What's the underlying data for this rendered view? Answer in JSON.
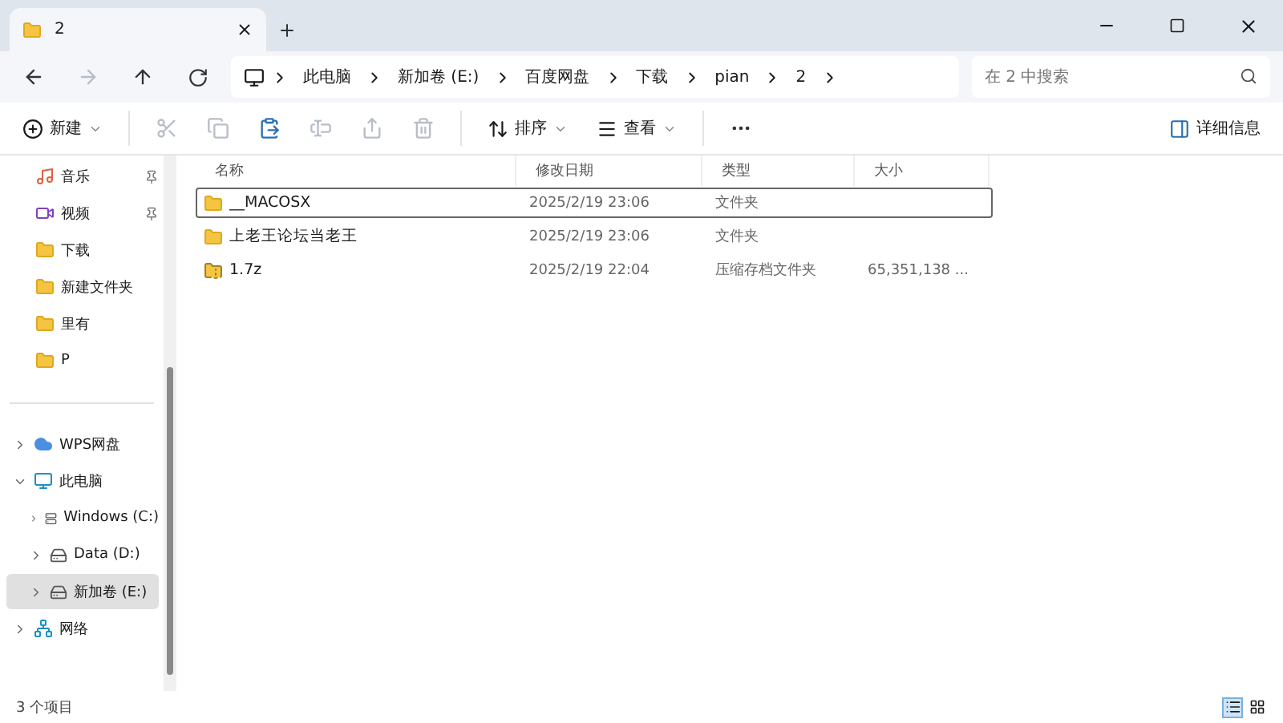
{
  "tab": {
    "title": "2",
    "selected": true
  },
  "nav": {
    "back_disabled": false,
    "forward_disabled": true
  },
  "breadcrumb": [
    "此电脑",
    "新加卷 (E:)",
    "百度网盘",
    "下载",
    "pian",
    "2"
  ],
  "search": {
    "placeholder": "在 2 中搜索"
  },
  "toolbar": {
    "new_label": "新建",
    "actions": [
      {
        "kind": "cut",
        "disabled": true
      },
      {
        "kind": "copy",
        "disabled": true
      },
      {
        "kind": "paste",
        "disabled": false
      },
      {
        "kind": "rename",
        "disabled": true
      },
      {
        "kind": "share",
        "disabled": true
      },
      {
        "kind": "delete",
        "disabled": true
      }
    ],
    "sort_label": "排序",
    "view_label": "查看",
    "details_label": "详细信息"
  },
  "sidebar": {
    "quick": [
      {
        "label": "音乐",
        "kind": "music",
        "pinned": true
      },
      {
        "label": "视频",
        "kind": "video",
        "pinned": true
      },
      {
        "label": "下载",
        "kind": "folder",
        "pinned": false
      },
      {
        "label": "新建文件夹",
        "kind": "folder",
        "pinned": false
      },
      {
        "label": "里有",
        "kind": "folder",
        "pinned": false
      },
      {
        "label": "P",
        "kind": "folder",
        "pinned": false
      }
    ],
    "tree": [
      {
        "label": "WPS网盘",
        "kind": "cloud",
        "expanded": false,
        "selected": false
      },
      {
        "label": "此电脑",
        "kind": "pc",
        "expanded": true,
        "selected": false,
        "children": [
          {
            "label": "Windows (C:)",
            "kind": "system",
            "expanded": false,
            "selected": false
          },
          {
            "label": "Data (D:)",
            "kind": "drive",
            "expanded": false,
            "selected": false
          },
          {
            "label": "新加卷 (E:)",
            "kind": "drive",
            "expanded": false,
            "selected": true
          }
        ]
      },
      {
        "label": "网络",
        "kind": "network",
        "expanded": false,
        "selected": false
      }
    ]
  },
  "table": {
    "columns": [
      "名称",
      "修改日期",
      "类型",
      "大小"
    ],
    "rows": [
      {
        "kind": "folder",
        "name": "__MACOSX",
        "date": "2025/2/19 23:06",
        "type": "文件夹",
        "selected": true
      },
      {
        "kind": "folder",
        "name": "上老王论坛当老王",
        "date": "2025/2/19 23:06",
        "type": "文件夹",
        "selected": false
      },
      {
        "kind": "archive",
        "name": "1.7z",
        "date": "2025/2/19 22:04",
        "type": "压缩存档文件夹",
        "size": "65,351,138 ...",
        "selected": false
      }
    ]
  },
  "status_bar": {
    "count": "3 个项目",
    "views": [
      {
        "kind": "details",
        "selected": true
      },
      {
        "kind": "tiles",
        "selected": false
      }
    ]
  }
}
